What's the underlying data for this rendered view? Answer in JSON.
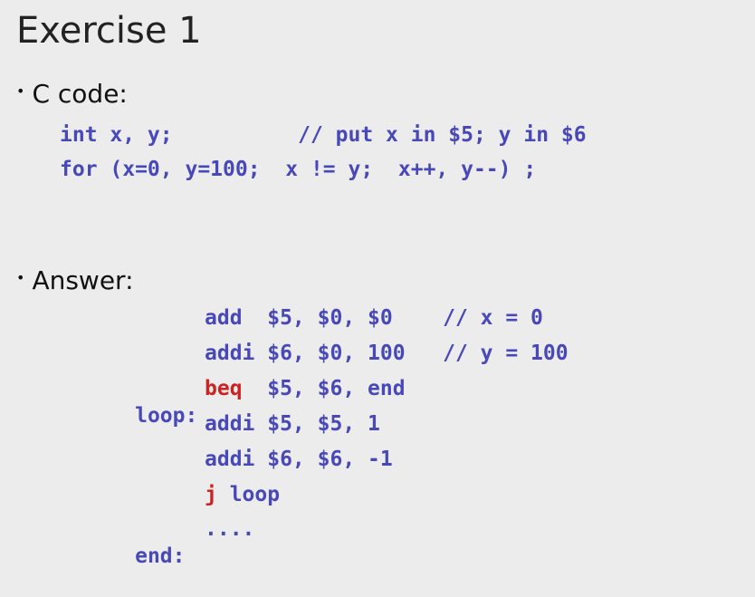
{
  "slide": {
    "title": "Exercise 1",
    "bullets": {
      "c_code": "C code:",
      "answer": "Answer:"
    },
    "bullet_glyph": "•"
  },
  "c_code": {
    "line1": "int x, y;          // put x in $5; y in $6",
    "line2": "for (x=0, y=100;  x != y;  x++, y--) ;"
  },
  "answer": {
    "lines": [
      {
        "label": "",
        "op": "add ",
        "args": " $5, $0, $0    // x = 0",
        "op_color": "blue"
      },
      {
        "label": "",
        "op": "addi",
        "args": " $6, $0, 100   // y = 100",
        "op_color": "blue"
      },
      {
        "label": "loop:",
        "op": "beq ",
        "args": " $5, $6, end",
        "op_color": "red"
      },
      {
        "label": "",
        "op": "addi",
        "args": " $5, $5, 1",
        "op_color": "blue"
      },
      {
        "label": "",
        "op": "addi",
        "args": " $6, $6, -1",
        "op_color": "blue"
      },
      {
        "label": "",
        "op": "j",
        "args": " loop",
        "op_color": "red"
      },
      {
        "label": "end:",
        "op": "....",
        "args": "",
        "op_color": "blue"
      }
    ]
  },
  "colors": {
    "background": "#ececec",
    "code_blue": "#4848b8",
    "keyword_red": "#cc2222",
    "text": "#111111"
  }
}
